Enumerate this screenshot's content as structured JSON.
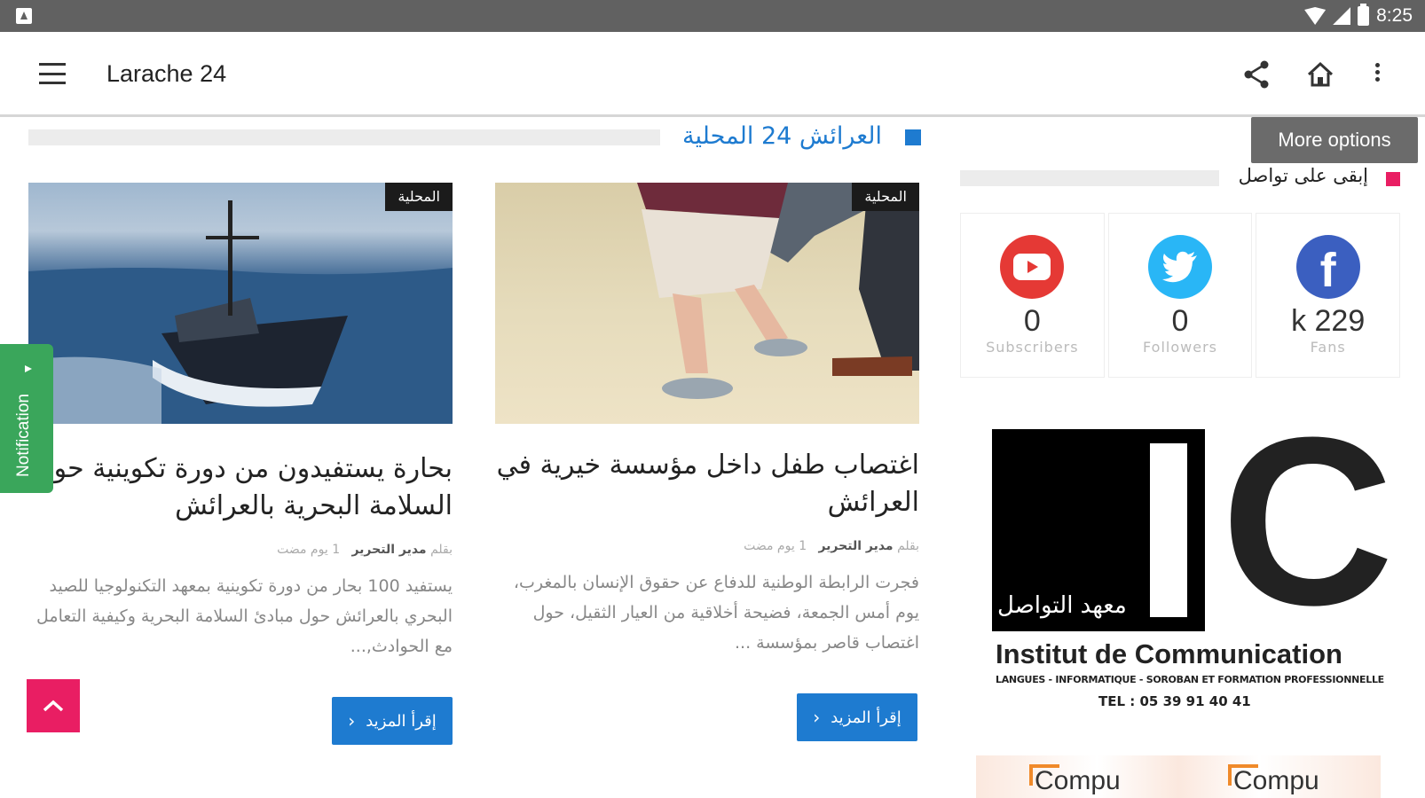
{
  "status_bar": {
    "time": "8:25"
  },
  "app_bar": {
    "title": "Larache 24"
  },
  "tooltip": {
    "text": "More options"
  },
  "section": {
    "title": "العرائش 24 المحلية"
  },
  "articles": [
    {
      "badge": "المحلية",
      "headline": "اغتصاب طفل داخل مؤسسة خيرية في العرائش",
      "meta_by": "بقلم",
      "author": "مدير التحرير",
      "time": "1 يوم مضت",
      "excerpt": "فجرت الرابطة الوطنية للدفاع عن حقوق الإنسان بالمغرب، يوم أمس الجمعة، فضيحة أخلاقية من العيار الثقيل، حول اغتصاب قاصر بمؤسسة ...",
      "read_more": "إقرأ المزيد"
    },
    {
      "badge": "المحلية",
      "headline": "بحارة يستفيدون من دورة تكوينية حول السلامة البحرية بالعرائش",
      "meta_by": "بقلم",
      "author": "مدير التحرير",
      "time": "1 يوم مضت",
      "excerpt": "يستفيد 100 بحار من دورة تكوينية بمعهد التكنولوجيا للصيد البحري بالعرائش حول مبادئ السلامة البحرية وكيفية التعامل مع الحوادث,...",
      "read_more": "إقرأ المزيد"
    }
  ],
  "notification_tab": {
    "label": "Notification"
  },
  "sidebar": {
    "title": "إبقى على تواصل",
    "social": [
      {
        "network": "youtube",
        "icon": "youtube-icon",
        "count": "0",
        "label": "Subscribers",
        "color": "#e53935"
      },
      {
        "network": "twitter",
        "icon": "twitter-icon",
        "count": "0",
        "label": "Followers",
        "color": "#29b6f6"
      },
      {
        "network": "facebook",
        "icon": "facebook-icon",
        "count": "k 229",
        "label": "Fans",
        "color": "#3b5fc0"
      }
    ]
  },
  "ad": {
    "arabic": "معهد التواصل",
    "letters": "C",
    "institute": "Institut de Communication",
    "subtitle": "LANGUES - INFORMATIQUE - SOROBAN ET FORMATION PROFESSIONNELLE",
    "tel": "TEL : 05 39 91 40 41"
  },
  "ad2": {
    "logo_text": "Compu"
  },
  "colors": {
    "accent": "#1e7bd0",
    "pink": "#e91e63",
    "green": "#3aa65b"
  }
}
